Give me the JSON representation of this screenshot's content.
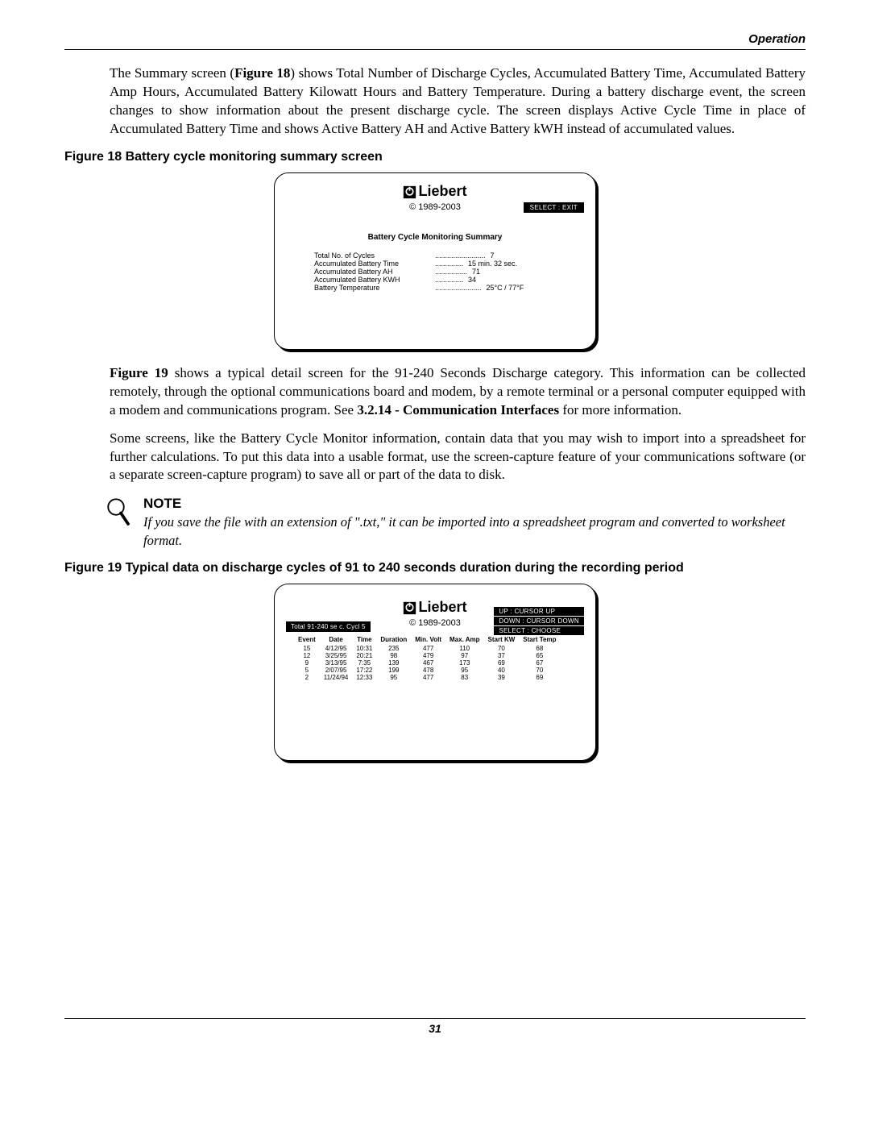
{
  "header": {
    "section": "Operation"
  },
  "para1_a": "The Summary screen (",
  "para1_b": "Figure 18",
  "para1_c": ") shows Total Number of Discharge Cycles, Accumulated Battery Time, Accumulated Battery Amp Hours, Accumulated Battery Kilowatt Hours and Battery Temperature. During a battery discharge event, the screen changes to show information about the present discharge cycle. The screen displays Active Cycle Time in place of Accumulated Battery Time and shows Active Battery AH and Active Battery kWH instead of accumulated values.",
  "fig18_caption": "Figure 18   Battery cycle monitoring summary screen",
  "screen18": {
    "brand": "Liebert",
    "copyright": "© 1989-2003",
    "menu": "SELECT :  EXIT",
    "title": "Battery Cycle Monitoring Summary",
    "rows": [
      {
        "label": "Total No. of Cycles",
        "dots": ".........................",
        "value": "7"
      },
      {
        "label": "Accumulated Battery Time",
        "dots": "..............",
        "value": "15 min. 32 sec."
      },
      {
        "label": "Accumulated Battery AH",
        "dots": "................",
        "value": "71"
      },
      {
        "label": "Accumulated Battery KWH",
        "dots": "..............",
        "value": "34"
      },
      {
        "label": "Battery Temperature",
        "dots": ".......................",
        "value": "25°C / 77°F"
      }
    ]
  },
  "para2_a": "Figure 19",
  "para2_b": " shows a typical detail screen for the 91-240 Seconds Discharge category. This information can be collected remotely, through the optional communications board and modem, by a remote terminal or a personal computer equipped with a modem and communications program. See ",
  "para2_c": "3.2.14 - Communication Interfaces",
  "para2_d": " for more information.",
  "para3": "Some screens, like the Battery Cycle Monitor information, contain data that you may wish to import into a spreadsheet for further calculations. To put this data into a usable format, use the screen-capture feature of your communications software (or a separate screen-capture program) to save all or part of the data to disk.",
  "note": {
    "title": "NOTE",
    "text": "If you save the file with an extension of \".txt,\" it can be imported into a spreadsheet program and converted to worksheet format."
  },
  "fig19_caption": "Figure 19   Typical data on discharge cycles of 91 to 240 seconds duration during the recording period",
  "screen19": {
    "brand": "Liebert",
    "copyright": "© 1989-2003",
    "totalbar": "Total    91-240  se c.  Cycl    5",
    "menu": [
      "UP  :  CURSOR UP",
      "DOWN  :  CURSOR DOWN",
      "SELECT  :  CHOOSE"
    ],
    "headers": [
      "Event",
      "Date",
      "Time",
      "Duration",
      "Min. Volt",
      "Max. Amp",
      "Start KW",
      "Start Temp"
    ],
    "rows": [
      [
        "15",
        "4/12/95",
        "10:31",
        "235",
        "477",
        "110",
        "70",
        "68"
      ],
      [
        "12",
        "3/25/95",
        "20:21",
        "98",
        "479",
        "97",
        "37",
        "65"
      ],
      [
        "9",
        "3/13/95",
        "7:35",
        "139",
        "467",
        "173",
        "69",
        "67"
      ],
      [
        "5",
        "2/07/95",
        "17:22",
        "199",
        "478",
        "95",
        "40",
        "70"
      ],
      [
        "2",
        "11/24/94",
        "12:33",
        "95",
        "477",
        "83",
        "39",
        "69"
      ]
    ]
  },
  "chart_data": {
    "type": "table",
    "title": "Typical data on discharge cycles of 91 to 240 seconds duration during the recording period",
    "columns": [
      "Event",
      "Date",
      "Time",
      "Duration",
      "Min. Volt",
      "Max. Amp",
      "Start KW",
      "Start Temp"
    ],
    "rows": [
      [
        15,
        "4/12/95",
        "10:31",
        235,
        477,
        110,
        70,
        68
      ],
      [
        12,
        "3/25/95",
        "20:21",
        98,
        479,
        97,
        37,
        65
      ],
      [
        9,
        "3/13/95",
        "7:35",
        139,
        467,
        173,
        69,
        67
      ],
      [
        5,
        "2/07/95",
        "17:22",
        199,
        478,
        95,
        40,
        70
      ],
      [
        2,
        "11/24/94",
        "12:33",
        95,
        477,
        83,
        39,
        69
      ]
    ]
  },
  "page_number": "31"
}
